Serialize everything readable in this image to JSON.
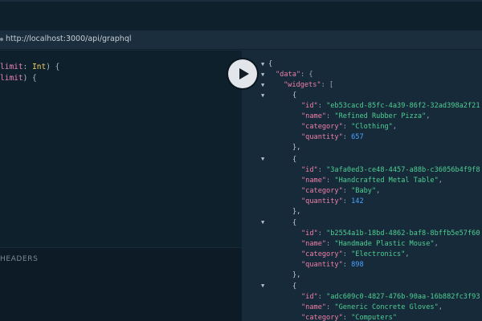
{
  "window": {
    "url": "http://localhost:3000/api/graphql"
  },
  "editor": {
    "query_lines": [
      {
        "arg": "limit",
        "sep": ": ",
        "type": "Int",
        "tail": ") {"
      },
      {
        "arg": "limit",
        "tail": ") {"
      }
    ],
    "headers_label": "HEADERS"
  },
  "run_button": {
    "icon": "play-icon"
  },
  "result": {
    "root_key": "\"data\"",
    "list_key": "\"widgets\"",
    "fields": {
      "id": "\"id\"",
      "name": "\"name\"",
      "category": "\"category\"",
      "quantity": "\"quantity\""
    },
    "widgets": [
      {
        "id": "\"eb53cacd-85fc-4a39-86f2-32ad398a2f21",
        "name": "\"Refined Rubber Pizza\"",
        "category": "\"Clothing\"",
        "quantity": "657"
      },
      {
        "id": "\"3afa0ed3-ce48-4457-a88b-c36056b4f9f8",
        "name": "\"Handcrafted Metal Table\"",
        "category": "\"Baby\"",
        "quantity": "142"
      },
      {
        "id": "\"b2554a1b-18bd-4862-baf8-8bffb5e57f60",
        "name": "\"Handmade Plastic Mouse\"",
        "category": "\"Electronics\"",
        "quantity": "898"
      },
      {
        "id": "\"adc609c0-4827-476b-90aa-16b882fc3f93",
        "name": "\"Generic Concrete Gloves\"",
        "category": "\"Computers\""
      }
    ]
  }
}
